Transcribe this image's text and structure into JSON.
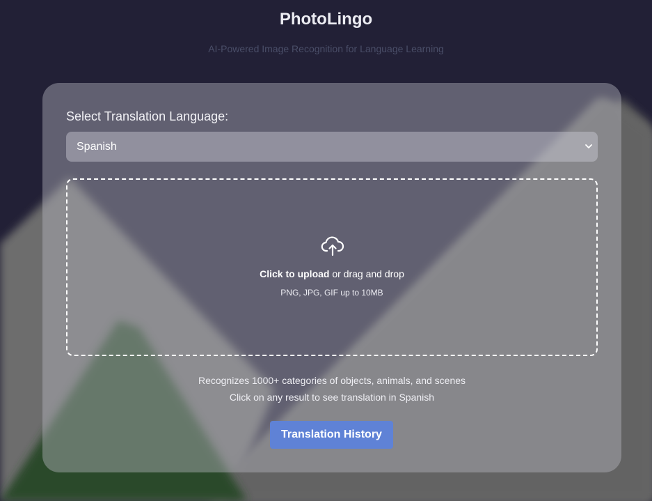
{
  "app": {
    "title": "PhotoLingo",
    "subtitle": "AI-Powered Image Recognition for Language Learning"
  },
  "language": {
    "label": "Select Translation Language:",
    "selected": "Spanish"
  },
  "upload": {
    "icon": "cloud-upload-icon",
    "action": "Click to upload",
    "rest": " or drag and drop",
    "hint": "PNG, JPG, GIF up to 10MB"
  },
  "info": {
    "line1": "Recognizes 1000+ categories of objects, animals, and scenes",
    "line2": "Click on any result to see translation in Spanish"
  },
  "buttons": {
    "history": "Translation History"
  },
  "colors": {
    "background": "#222036",
    "accent": "#5f82d6"
  }
}
